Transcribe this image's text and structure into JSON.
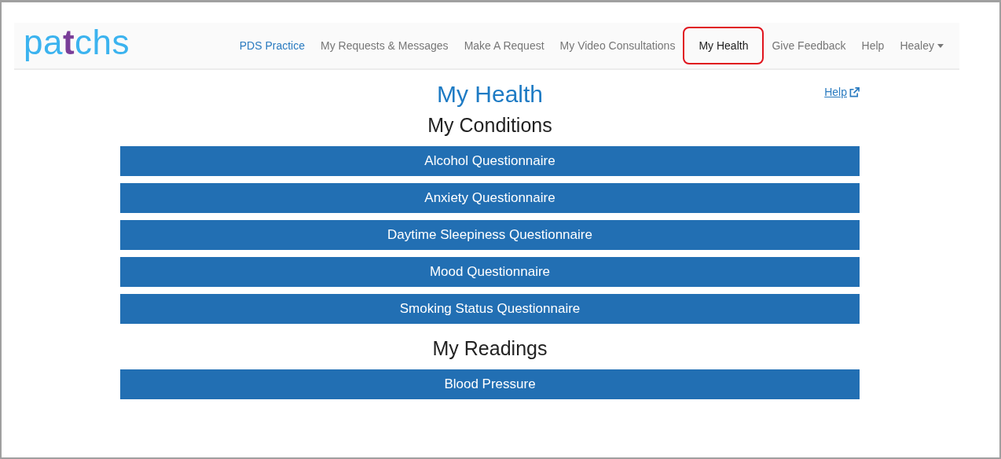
{
  "logo": {
    "text": "patchs"
  },
  "nav": [
    {
      "label": "PDS Practice",
      "kind": "brand",
      "selected": false
    },
    {
      "label": "My Requests & Messages",
      "kind": "link",
      "selected": false
    },
    {
      "label": "Make A Request",
      "kind": "link",
      "selected": false
    },
    {
      "label": "My Video Consultations",
      "kind": "link",
      "selected": false
    },
    {
      "label": "My Health",
      "kind": "link",
      "selected": true
    },
    {
      "label": "Give Feedback",
      "kind": "link",
      "selected": false
    },
    {
      "label": "Help",
      "kind": "link",
      "selected": false
    },
    {
      "label": "Healey",
      "kind": "dropdown",
      "selected": false
    }
  ],
  "page": {
    "title": "My Health",
    "help_link": "Help"
  },
  "sections": [
    {
      "heading": "My Conditions",
      "buttons": [
        "Alcohol Questionnaire",
        "Anxiety Questionnaire",
        "Daytime Sleepiness Questionnaire",
        "Mood Questionnaire",
        "Smoking Status Questionnaire"
      ]
    },
    {
      "heading": "My Readings",
      "buttons": [
        "Blood Pressure"
      ]
    }
  ]
}
